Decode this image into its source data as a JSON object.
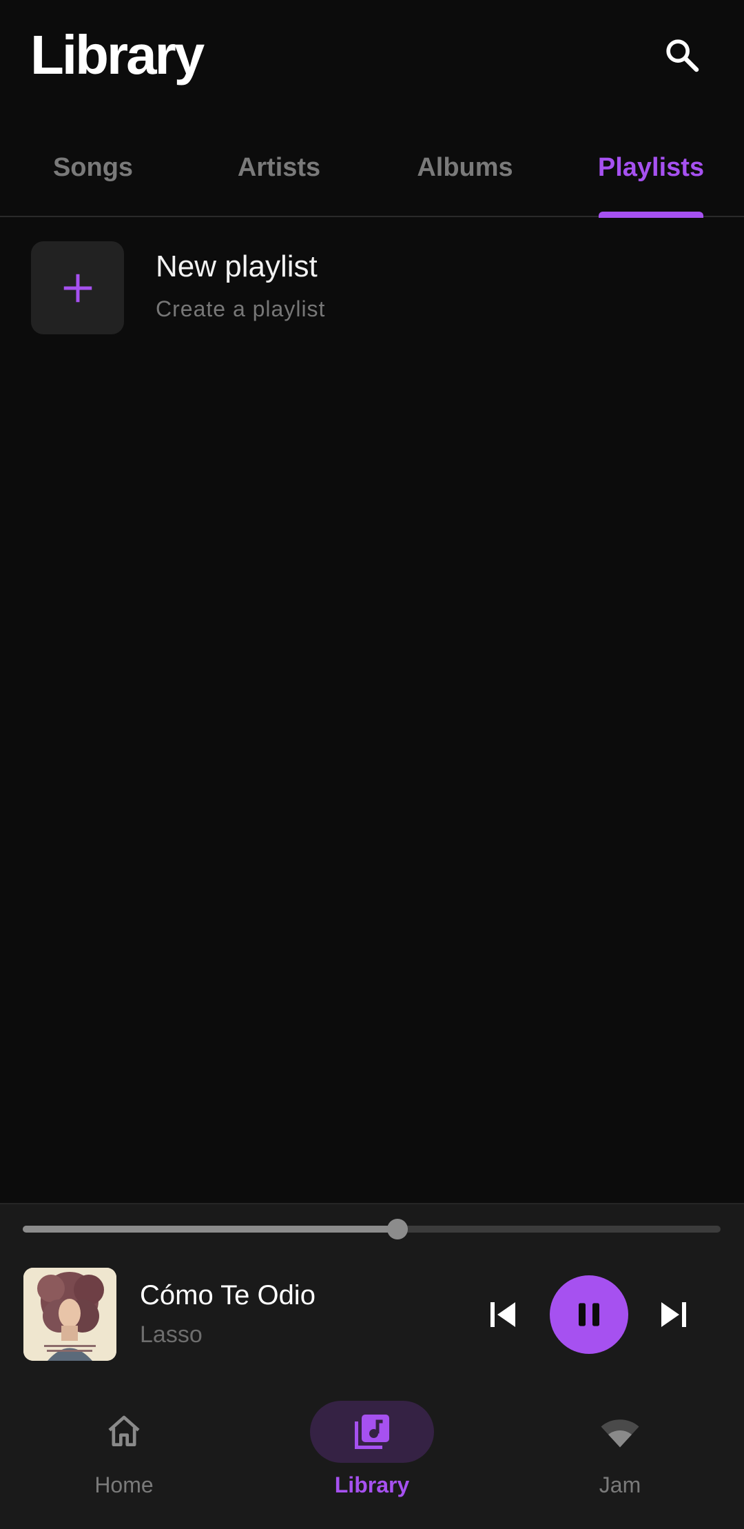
{
  "header": {
    "title": "Library",
    "search_icon": "search-icon"
  },
  "tabs": [
    {
      "label": "Songs",
      "active": false
    },
    {
      "label": "Artists",
      "active": false
    },
    {
      "label": "Albums",
      "active": false
    },
    {
      "label": "Playlists",
      "active": true
    }
  ],
  "new_playlist": {
    "title": "New playlist",
    "subtitle": "Create a playlist",
    "icon": "plus-icon"
  },
  "player": {
    "track_title": "Cómo Te Odio",
    "artist": "Lasso",
    "progress": 0.537,
    "state": "playing",
    "icons": {
      "previous": "skip-previous-icon",
      "pause": "pause-icon",
      "next": "skip-next-icon"
    }
  },
  "nav": [
    {
      "label": "Home",
      "icon": "home-icon",
      "active": false
    },
    {
      "label": "Library",
      "icon": "library-music-icon",
      "active": true
    },
    {
      "label": "Jam",
      "icon": "wifi-icon",
      "active": false
    }
  ],
  "colors": {
    "accent": "#a651f0",
    "background": "#0c0c0c",
    "surface": "#1a1a1a",
    "muted_text": "#7a7a7a"
  }
}
